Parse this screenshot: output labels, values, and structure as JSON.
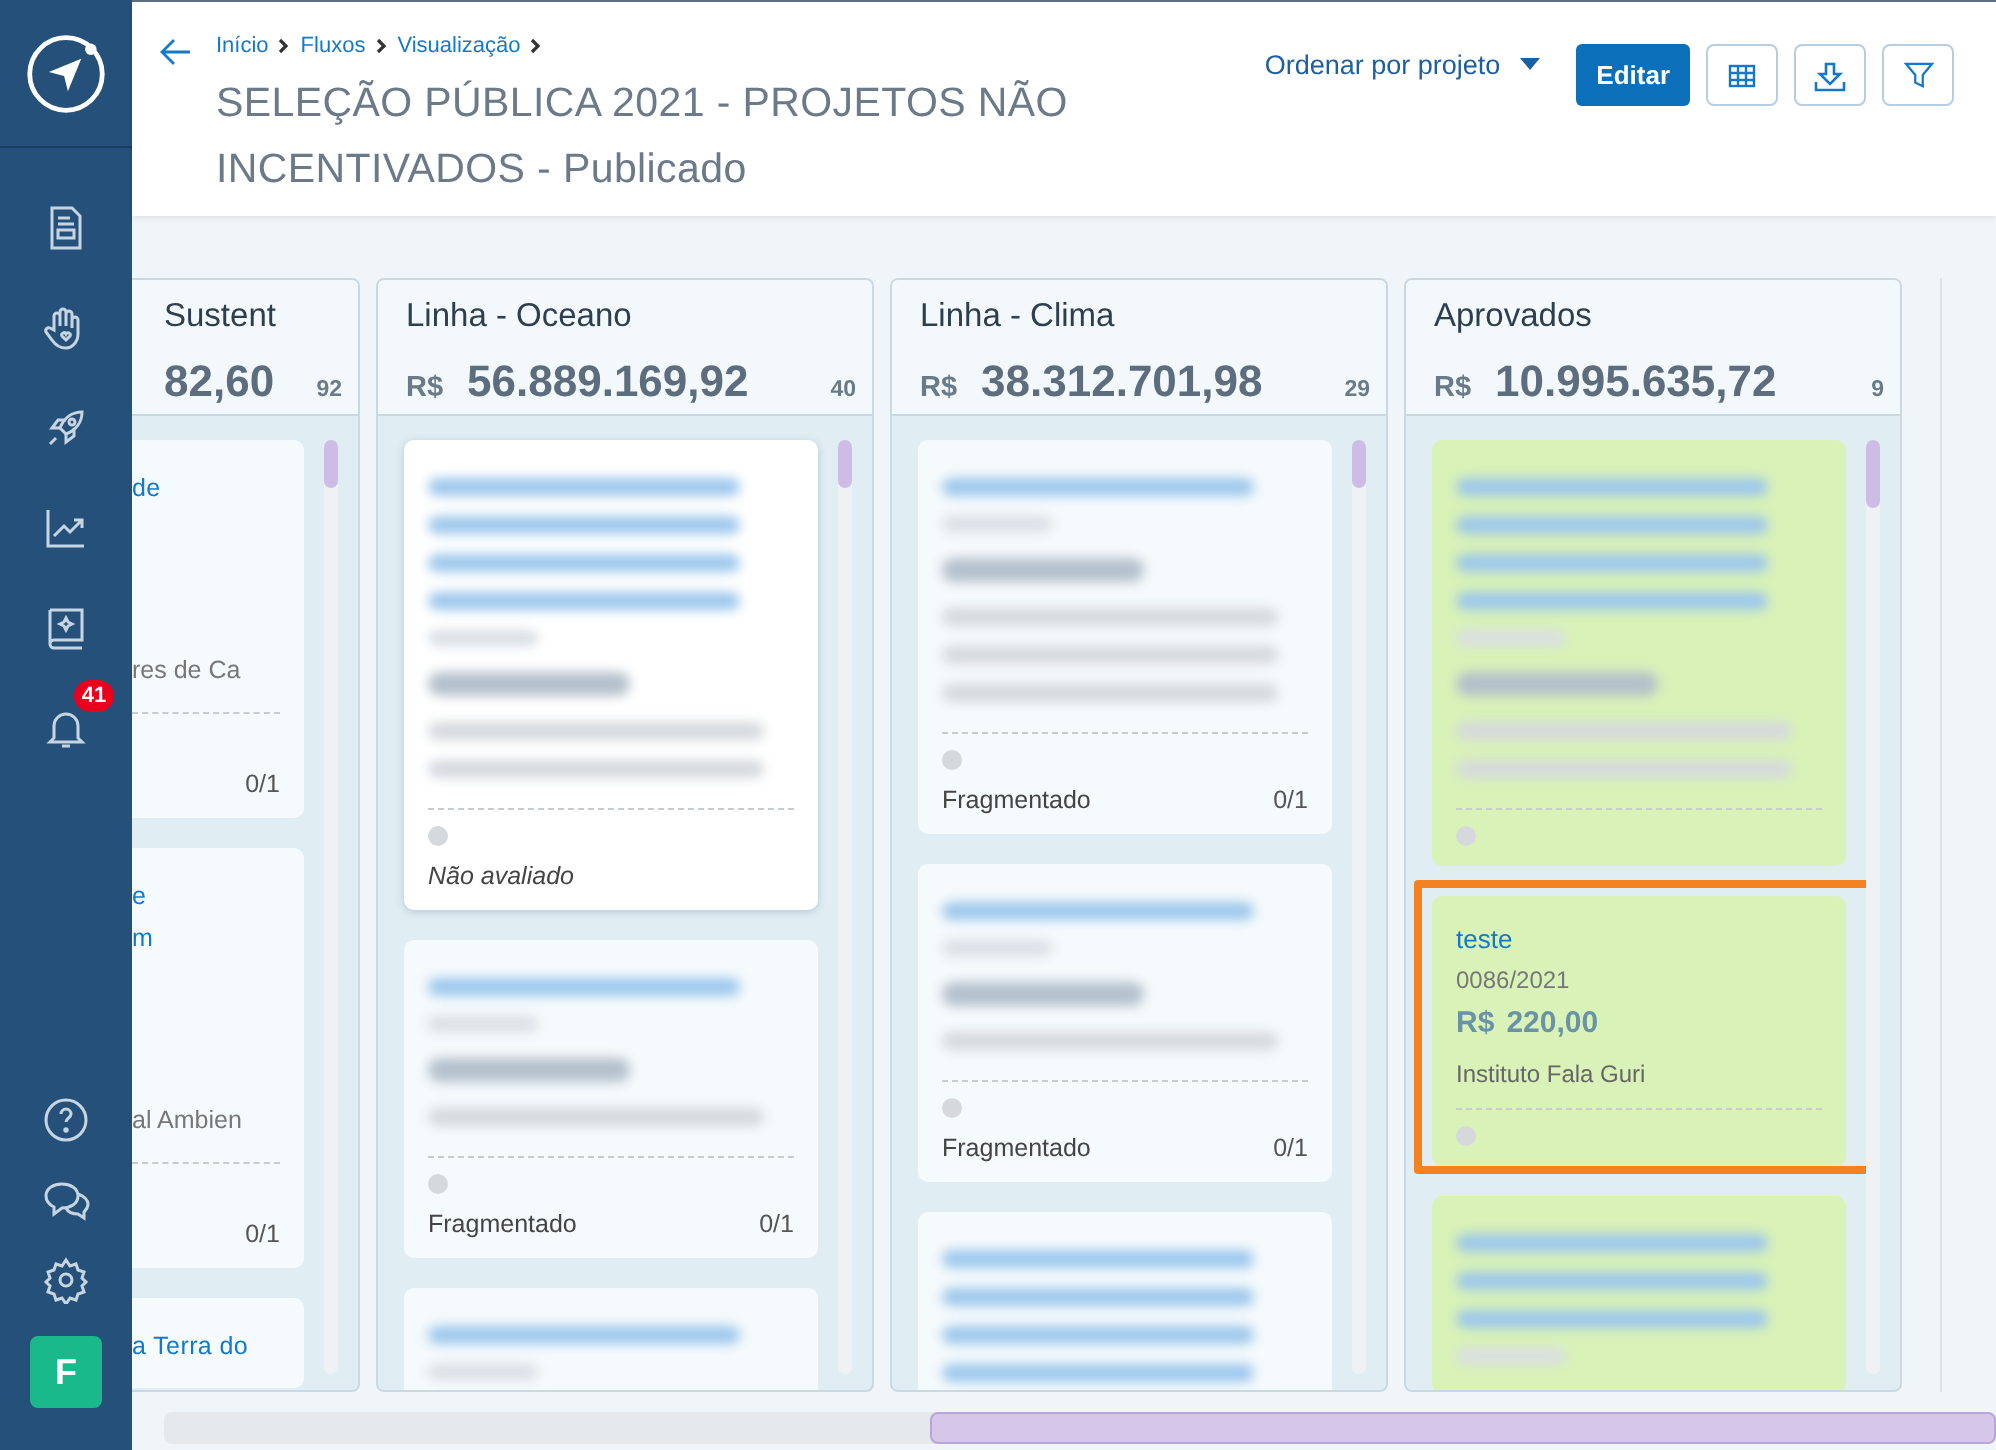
{
  "header": {
    "breadcrumb": [
      "Início",
      "Fluxos",
      "Visualização"
    ],
    "title": "SELEÇÃO PÚBLICA 2021 - PROJETOS NÃO INCENTIVADOS - Publicado",
    "sort": "Ordenar por projeto",
    "edit_button": "Editar"
  },
  "sidebar": {
    "notifications_badge": "41",
    "avatar": "F"
  },
  "partial_column": {
    "title": "Sustent",
    "total": "82,60",
    "count": "92",
    "cards": [
      {
        "lines": [
          {
            "kind": "title",
            "text": "de"
          },
          {
            "kind": "org",
            "text": "res de Ca"
          }
        ],
        "count": "0/1"
      },
      {
        "lines": [
          {
            "kind": "title",
            "text": "e"
          },
          {
            "kind": "title",
            "text": "m"
          },
          {
            "kind": "org",
            "text": "al Ambien"
          }
        ],
        "count": "0/1"
      },
      {
        "lines": [
          {
            "kind": "title",
            "text": "a Terra do"
          }
        ]
      }
    ]
  },
  "columns": [
    {
      "title": "Linha - Oceano",
      "currency": "R$",
      "total": "56.889.169,92",
      "count": "40",
      "color": "#f5fafc",
      "cards": [
        {
          "blurred": [
            {
              "kind": "title"
            },
            {
              "kind": "title"
            },
            {
              "kind": "title"
            },
            {
              "kind": "title"
            },
            {
              "kind": "date"
            },
            {
              "kind": "amount"
            },
            {
              "kind": "org"
            },
            {
              "kind": "org"
            }
          ],
          "status": {
            "text": "Não avaliado",
            "italic": true
          },
          "highlight": true,
          "selected": false
        },
        {
          "blurred": [
            {
              "kind": "title"
            },
            {
              "kind": "date"
            },
            {
              "kind": "amount"
            },
            {
              "kind": "org"
            }
          ],
          "status": {
            "text": "Fragmentado",
            "italic": false
          },
          "progress": "0/1",
          "highlight": false,
          "selected": false
        },
        {
          "blurred": [
            {
              "kind": "title"
            },
            {
              "kind": "date"
            }
          ],
          "highlight": false,
          "selected": false
        }
      ]
    },
    {
      "title": "Linha - Clima",
      "currency": "R$",
      "total": "38.312.701,98",
      "count": "29",
      "color": "#f5fafc",
      "cards": [
        {
          "blurred": [
            {
              "kind": "title"
            },
            {
              "kind": "date"
            },
            {
              "kind": "amount"
            },
            {
              "kind": "org"
            },
            {
              "kind": "org"
            },
            {
              "kind": "org"
            }
          ],
          "status": {
            "text": "Fragmentado",
            "italic": false
          },
          "progress": "0/1",
          "selected": false
        },
        {
          "blurred": [
            {
              "kind": "title"
            },
            {
              "kind": "date"
            },
            {
              "kind": "amount"
            },
            {
              "kind": "org"
            }
          ],
          "status": {
            "text": "Fragmentado",
            "italic": false
          },
          "progress": "0/1",
          "selected": false
        },
        {
          "blurred": [
            {
              "kind": "title"
            },
            {
              "kind": "title"
            },
            {
              "kind": "title"
            },
            {
              "kind": "title"
            }
          ],
          "selected": false
        }
      ]
    },
    {
      "title": "Aprovados",
      "currency": "R$",
      "total": "10.995.635,72",
      "count": "9",
      "color": "#d9f2b8",
      "cards": [
        {
          "blurred": [
            {
              "kind": "title"
            },
            {
              "kind": "title"
            },
            {
              "kind": "title"
            },
            {
              "kind": "title"
            },
            {
              "kind": "date"
            },
            {
              "kind": "amount"
            },
            {
              "kind": "org"
            },
            {
              "kind": "org"
            }
          ],
          "selected": false
        },
        {
          "title": "teste",
          "date": "0086/2021",
          "currency": "R$",
          "amount": "220,00",
          "org": "Instituto Fala Guri",
          "selected": true
        },
        {
          "blurred": [
            {
              "kind": "title"
            },
            {
              "kind": "title"
            },
            {
              "kind": "title"
            },
            {
              "kind": "date"
            }
          ],
          "selected": false
        }
      ]
    }
  ]
}
